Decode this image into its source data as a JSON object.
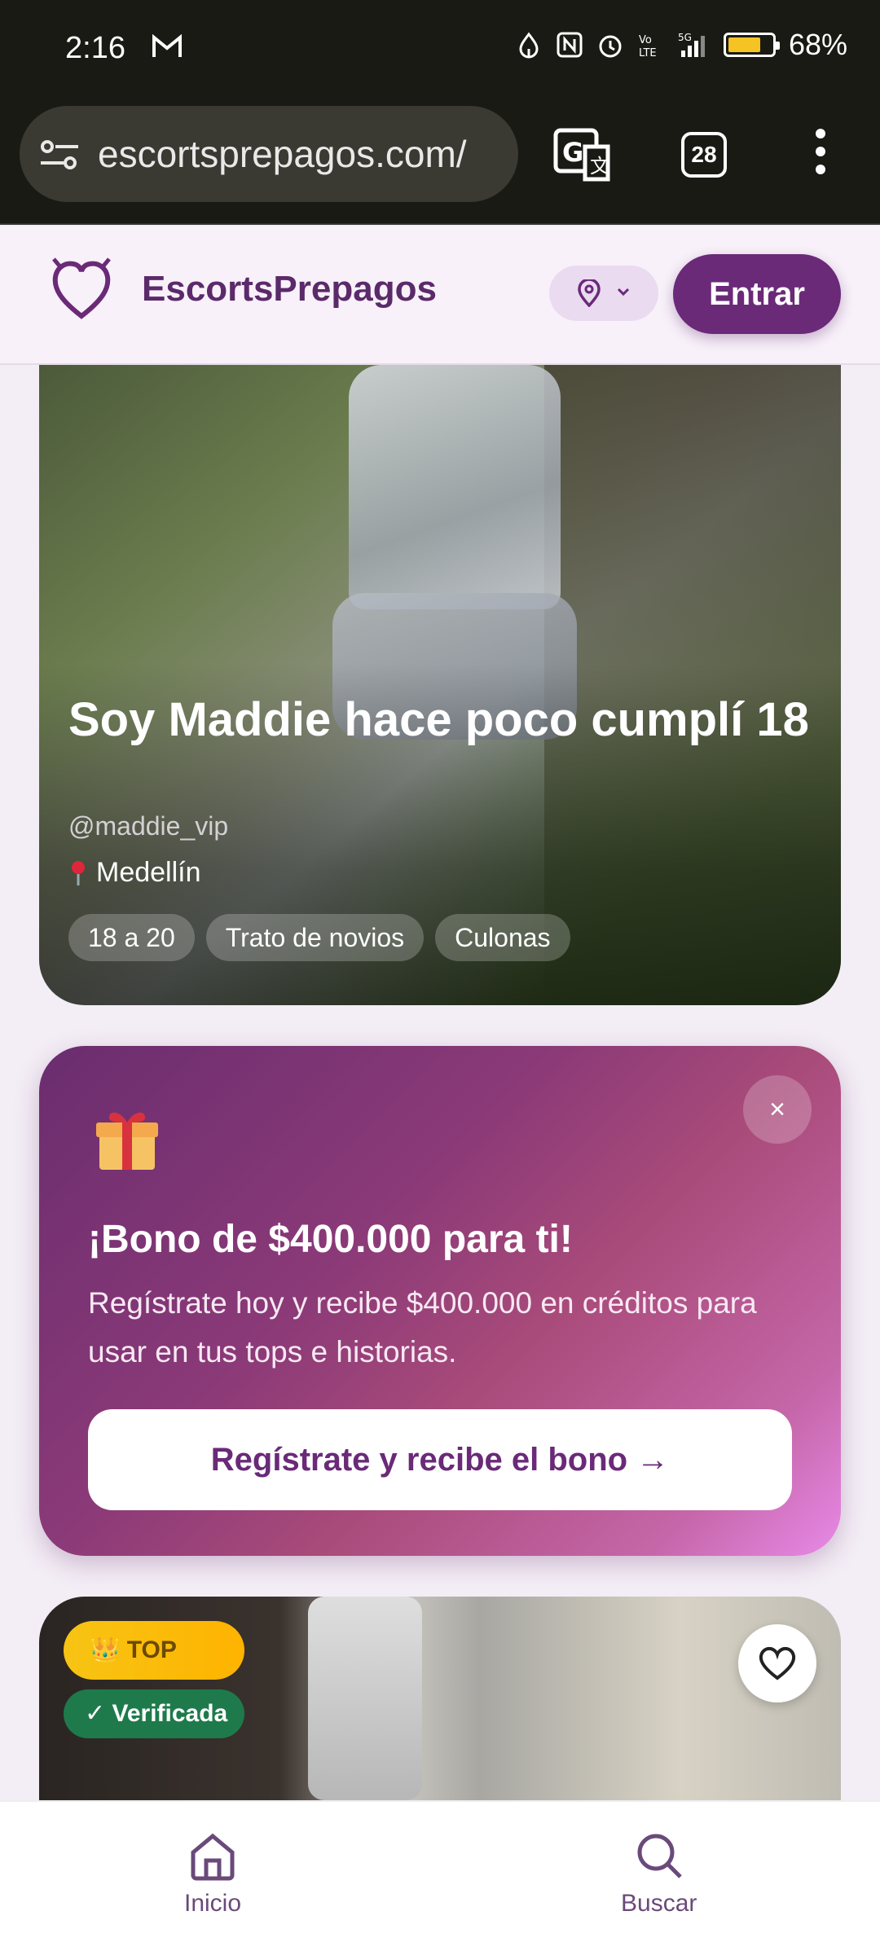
{
  "status_bar": {
    "time": "2:16",
    "battery": "68%"
  },
  "browser": {
    "url": "escortsprepagos.com/",
    "tab_count": "28"
  },
  "site": {
    "brand": "EscortsPrepagos",
    "login_label": "Entrar"
  },
  "profile_card": {
    "title": "Soy Maddie hace poco cumplí 18",
    "handle": "@maddie_vip",
    "city": "Medellín",
    "tags": [
      "18 a 20",
      "Trato de novios",
      "Culonas"
    ]
  },
  "promo": {
    "close_label": "×",
    "heading": "¡Bono de $400.000 para ti!",
    "body": "Regístrate hoy y recibe $400.000 en créditos para usar en tus tops e historias.",
    "cta": "Regístrate y recibe el bono →"
  },
  "profile_card_2": {
    "top_badge": "TOP",
    "verified_badge": "Verificada"
  },
  "bottom_nav": {
    "home": "Inicio",
    "search": "Buscar"
  },
  "colors": {
    "brand": "#6a2a78",
    "battery": "#f6c324",
    "verified": "#1e7a4b",
    "top": "#f7c414"
  }
}
